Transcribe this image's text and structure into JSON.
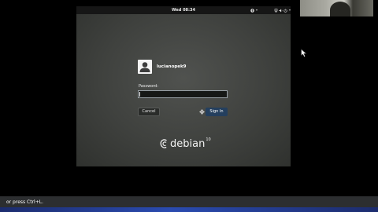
{
  "vm_screen": {
    "top_bar": {
      "clock": "Wed 08:34",
      "accessibility_icon": "accessibility-icon",
      "network_icon": "network-icon",
      "volume_icon": "volume-icon",
      "power_icon": "power-icon",
      "dropdown_icon": "chevron-down-icon"
    },
    "login": {
      "username": "lucianopek9",
      "avatar_icon": "user-avatar-icon",
      "password_label": "Password:",
      "password_value": "",
      "cancel_label": "Cancel",
      "session_icon": "gear-icon",
      "signin_label": "Sign In"
    },
    "logo": {
      "swirl_icon": "debian-swirl-icon",
      "text": "debian",
      "version": "10"
    }
  },
  "host": {
    "hint_text": "or press Ctrl+L.",
    "cursor_icon": "mouse-pointer-icon"
  },
  "colors": {
    "background": "#000000",
    "vm_bg": "#474946",
    "top_bar": "#161616",
    "signin_button": "#243f5e",
    "hint_bar": "#2c2e30",
    "hint_accent": "#2a4bb0"
  }
}
